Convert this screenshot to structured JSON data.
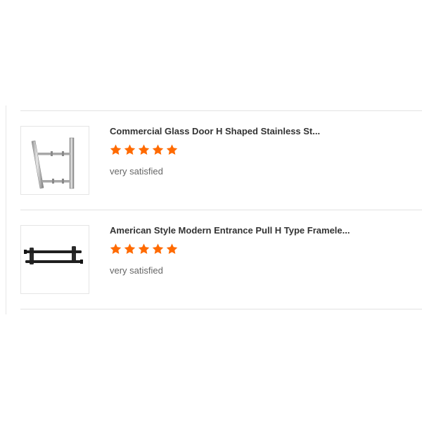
{
  "reviews": [
    {
      "title": "Commercial Glass Door H Shaped Stainless St...",
      "rating": 5,
      "comment": "very satisfied",
      "thumbnail_icon": "stainless-h-handle-icon"
    },
    {
      "title": "American Style Modern Entrance Pull H Type Framele...",
      "rating": 5,
      "comment": "very satisfied",
      "thumbnail_icon": "black-h-handle-icon"
    }
  ],
  "colors": {
    "star": "#ff6a00",
    "divider": "#e2e2e2"
  }
}
